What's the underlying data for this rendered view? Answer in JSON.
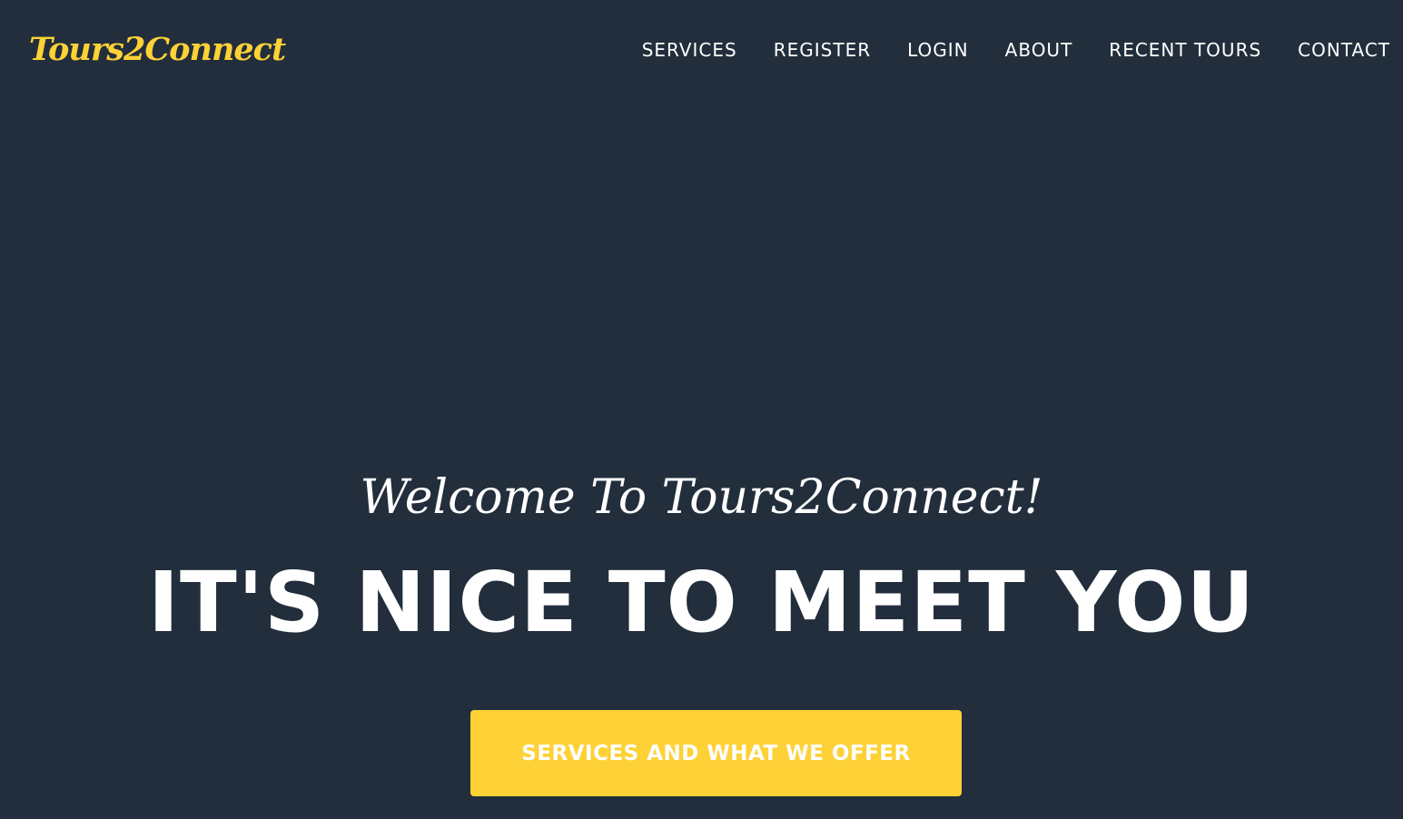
{
  "navbar": {
    "brand": "Tours2Connect",
    "links": [
      "SERVICES",
      "REGISTER",
      "LOGIN",
      "ABOUT",
      "RECENT TOURS",
      "CONTACT"
    ]
  },
  "hero": {
    "subheading": "Welcome To Tours2Connect!",
    "heading": "IT'S NICE TO MEET YOU",
    "button_label": "SERVICES AND WHAT WE OFFER"
  },
  "colors": {
    "background": "#222e3c",
    "accent": "#fed136",
    "text": "#ffffff"
  }
}
